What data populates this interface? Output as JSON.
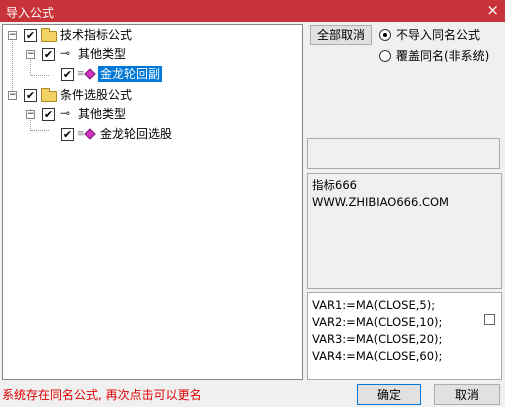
{
  "window": {
    "title": "导入公式",
    "close_glyph": "×"
  },
  "tree": {
    "nodes": [
      {
        "label": "技术指标公式",
        "checked": true,
        "expand": "−"
      },
      {
        "label": "其他类型",
        "checked": true,
        "expand": "−"
      },
      {
        "label": "金龙轮回副",
        "checked": true,
        "selected": true
      },
      {
        "label": "条件选股公式",
        "checked": true,
        "expand": "−"
      },
      {
        "label": "其他类型",
        "checked": true,
        "expand": "−"
      },
      {
        "label": "金龙轮回选股",
        "checked": true
      }
    ],
    "check_glyph": "✔"
  },
  "actions": {
    "cancel_all_label": "全部取消",
    "radio_no_import_label": "不导入同名公式",
    "radio_overwrite_label": "覆盖同名(非系统)",
    "ok_label": "确定",
    "cancel_label": "取消"
  },
  "description": {
    "line1": "指标666",
    "line2": "WWW.ZHIBIAO666.COM"
  },
  "code": {
    "lines": [
      "VAR1:=MA(CLOSE,5);",
      "VAR2:=MA(CLOSE,10);",
      "VAR3:=MA(CLOSE,20);",
      "VAR4:=MA(CLOSE,60);"
    ]
  },
  "status": {
    "message": "系统存在同名公式, 再次点击可以更名"
  }
}
